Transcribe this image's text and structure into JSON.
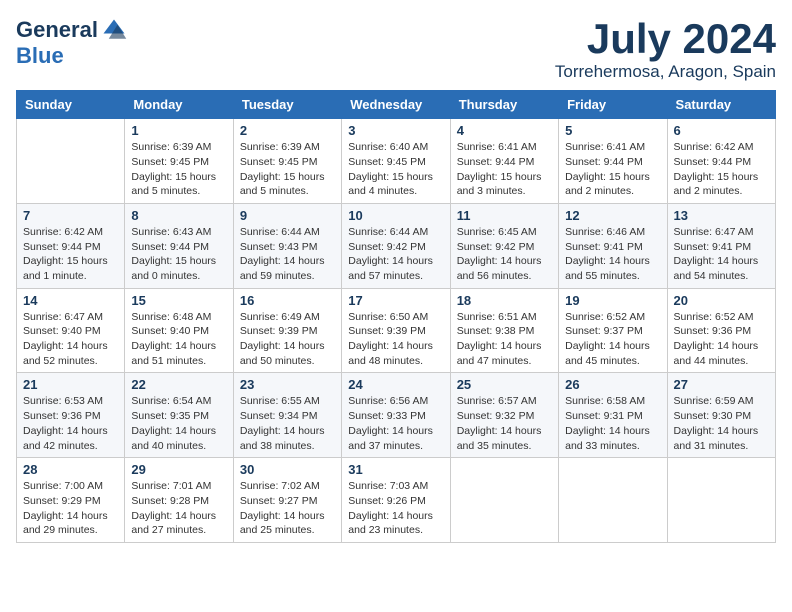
{
  "header": {
    "logo_general": "General",
    "logo_blue": "Blue",
    "month_title": "July 2024",
    "location": "Torrehermosa, Aragon, Spain"
  },
  "days_of_week": [
    "Sunday",
    "Monday",
    "Tuesday",
    "Wednesday",
    "Thursday",
    "Friday",
    "Saturday"
  ],
  "weeks": [
    [
      {
        "day": "",
        "info": ""
      },
      {
        "day": "1",
        "info": "Sunrise: 6:39 AM\nSunset: 9:45 PM\nDaylight: 15 hours\nand 5 minutes."
      },
      {
        "day": "2",
        "info": "Sunrise: 6:39 AM\nSunset: 9:45 PM\nDaylight: 15 hours\nand 5 minutes."
      },
      {
        "day": "3",
        "info": "Sunrise: 6:40 AM\nSunset: 9:45 PM\nDaylight: 15 hours\nand 4 minutes."
      },
      {
        "day": "4",
        "info": "Sunrise: 6:41 AM\nSunset: 9:44 PM\nDaylight: 15 hours\nand 3 minutes."
      },
      {
        "day": "5",
        "info": "Sunrise: 6:41 AM\nSunset: 9:44 PM\nDaylight: 15 hours\nand 2 minutes."
      },
      {
        "day": "6",
        "info": "Sunrise: 6:42 AM\nSunset: 9:44 PM\nDaylight: 15 hours\nand 2 minutes."
      }
    ],
    [
      {
        "day": "7",
        "info": "Sunrise: 6:42 AM\nSunset: 9:44 PM\nDaylight: 15 hours\nand 1 minute."
      },
      {
        "day": "8",
        "info": "Sunrise: 6:43 AM\nSunset: 9:44 PM\nDaylight: 15 hours\nand 0 minutes."
      },
      {
        "day": "9",
        "info": "Sunrise: 6:44 AM\nSunset: 9:43 PM\nDaylight: 14 hours\nand 59 minutes."
      },
      {
        "day": "10",
        "info": "Sunrise: 6:44 AM\nSunset: 9:42 PM\nDaylight: 14 hours\nand 57 minutes."
      },
      {
        "day": "11",
        "info": "Sunrise: 6:45 AM\nSunset: 9:42 PM\nDaylight: 14 hours\nand 56 minutes."
      },
      {
        "day": "12",
        "info": "Sunrise: 6:46 AM\nSunset: 9:41 PM\nDaylight: 14 hours\nand 55 minutes."
      },
      {
        "day": "13",
        "info": "Sunrise: 6:47 AM\nSunset: 9:41 PM\nDaylight: 14 hours\nand 54 minutes."
      }
    ],
    [
      {
        "day": "14",
        "info": "Sunrise: 6:47 AM\nSunset: 9:40 PM\nDaylight: 14 hours\nand 52 minutes."
      },
      {
        "day": "15",
        "info": "Sunrise: 6:48 AM\nSunset: 9:40 PM\nDaylight: 14 hours\nand 51 minutes."
      },
      {
        "day": "16",
        "info": "Sunrise: 6:49 AM\nSunset: 9:39 PM\nDaylight: 14 hours\nand 50 minutes."
      },
      {
        "day": "17",
        "info": "Sunrise: 6:50 AM\nSunset: 9:39 PM\nDaylight: 14 hours\nand 48 minutes."
      },
      {
        "day": "18",
        "info": "Sunrise: 6:51 AM\nSunset: 9:38 PM\nDaylight: 14 hours\nand 47 minutes."
      },
      {
        "day": "19",
        "info": "Sunrise: 6:52 AM\nSunset: 9:37 PM\nDaylight: 14 hours\nand 45 minutes."
      },
      {
        "day": "20",
        "info": "Sunrise: 6:52 AM\nSunset: 9:36 PM\nDaylight: 14 hours\nand 44 minutes."
      }
    ],
    [
      {
        "day": "21",
        "info": "Sunrise: 6:53 AM\nSunset: 9:36 PM\nDaylight: 14 hours\nand 42 minutes."
      },
      {
        "day": "22",
        "info": "Sunrise: 6:54 AM\nSunset: 9:35 PM\nDaylight: 14 hours\nand 40 minutes."
      },
      {
        "day": "23",
        "info": "Sunrise: 6:55 AM\nSunset: 9:34 PM\nDaylight: 14 hours\nand 38 minutes."
      },
      {
        "day": "24",
        "info": "Sunrise: 6:56 AM\nSunset: 9:33 PM\nDaylight: 14 hours\nand 37 minutes."
      },
      {
        "day": "25",
        "info": "Sunrise: 6:57 AM\nSunset: 9:32 PM\nDaylight: 14 hours\nand 35 minutes."
      },
      {
        "day": "26",
        "info": "Sunrise: 6:58 AM\nSunset: 9:31 PM\nDaylight: 14 hours\nand 33 minutes."
      },
      {
        "day": "27",
        "info": "Sunrise: 6:59 AM\nSunset: 9:30 PM\nDaylight: 14 hours\nand 31 minutes."
      }
    ],
    [
      {
        "day": "28",
        "info": "Sunrise: 7:00 AM\nSunset: 9:29 PM\nDaylight: 14 hours\nand 29 minutes."
      },
      {
        "day": "29",
        "info": "Sunrise: 7:01 AM\nSunset: 9:28 PM\nDaylight: 14 hours\nand 27 minutes."
      },
      {
        "day": "30",
        "info": "Sunrise: 7:02 AM\nSunset: 9:27 PM\nDaylight: 14 hours\nand 25 minutes."
      },
      {
        "day": "31",
        "info": "Sunrise: 7:03 AM\nSunset: 9:26 PM\nDaylight: 14 hours\nand 23 minutes."
      },
      {
        "day": "",
        "info": ""
      },
      {
        "day": "",
        "info": ""
      },
      {
        "day": "",
        "info": ""
      }
    ]
  ]
}
